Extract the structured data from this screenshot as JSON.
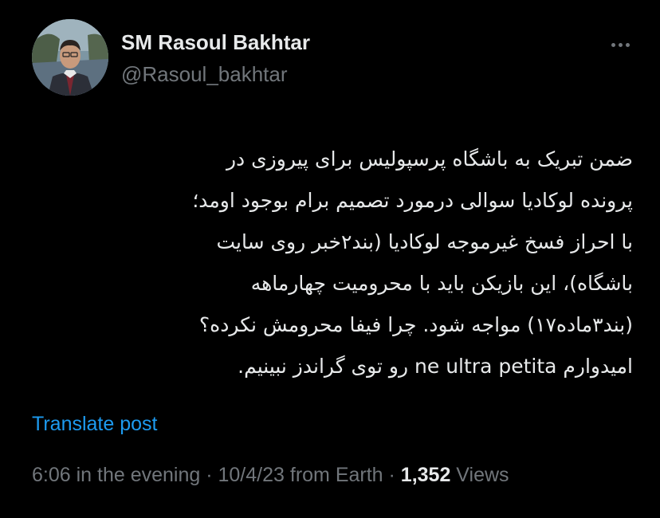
{
  "author": {
    "display_name": "SM Rasoul Bakhtar",
    "handle": "@Rasoul_bakhtar",
    "avatar_icon": "profile-photo"
  },
  "tweet": {
    "lines": [
      "ضمن تبریک به باشگاه پرسپولیس برای پیروزی در",
      "پرونده لوکادیا سوالی درمورد تصمیم برام بوجود اومد؛",
      "با احراز فسخ غیرموجه لوکادیا (بند۲خبر روی سایت",
      "باشگاه)، این بازیکن باید با محرومیت چهارماهه",
      "(بند۳ماده۱۷) مواجه شود. چرا فیفا محرومش نکرده؟",
      "امیدوارم ne ultra petita رو توی گراندز نبینیم."
    ]
  },
  "translate_label": "Translate post",
  "meta": {
    "time": "6:06 in the evening",
    "separator": " · ",
    "date": "10/4/23",
    "source": " from Earth",
    "views_count": "1,352",
    "views_label": " Views"
  },
  "colors": {
    "background": "#000000",
    "text": "#e7e9ea",
    "muted": "#71767b",
    "link": "#1d9bf0"
  }
}
